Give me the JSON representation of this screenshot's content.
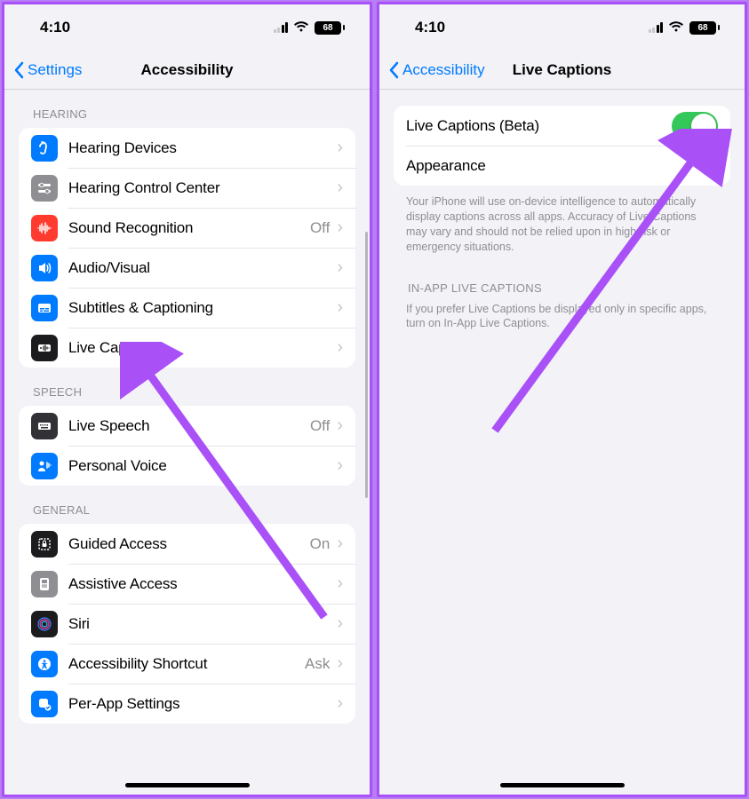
{
  "status": {
    "time": "4:10",
    "battery": "68"
  },
  "left": {
    "back": "Settings",
    "title": "Accessibility",
    "sections": [
      {
        "header": "HEARING",
        "rows": [
          {
            "icon": "ear",
            "bg": "bg-blue",
            "label": "Hearing Devices",
            "value": ""
          },
          {
            "icon": "sliders",
            "bg": "bg-gray",
            "label": "Hearing Control Center",
            "value": ""
          },
          {
            "icon": "wave",
            "bg": "bg-red",
            "label": "Sound Recognition",
            "value": "Off"
          },
          {
            "icon": "speaker",
            "bg": "bg-blue",
            "label": "Audio/Visual",
            "value": ""
          },
          {
            "icon": "caption",
            "bg": "bg-blue",
            "label": "Subtitles & Captioning",
            "value": ""
          },
          {
            "icon": "livecap",
            "bg": "bg-dark",
            "label": "Live Captions",
            "value": ""
          }
        ]
      },
      {
        "header": "SPEECH",
        "rows": [
          {
            "icon": "keyboard",
            "bg": "bg-darkgray",
            "label": "Live Speech",
            "value": "Off"
          },
          {
            "icon": "voice",
            "bg": "bg-blue",
            "label": "Personal Voice",
            "value": ""
          }
        ]
      },
      {
        "header": "GENERAL",
        "rows": [
          {
            "icon": "lock",
            "bg": "bg-dark",
            "label": "Guided Access",
            "value": "On"
          },
          {
            "icon": "assist",
            "bg": "bg-gray",
            "label": "Assistive Access",
            "value": ""
          },
          {
            "icon": "siri",
            "bg": "bg-siri",
            "label": "Siri",
            "value": ""
          },
          {
            "icon": "shortcut",
            "bg": "bg-blue",
            "label": "Accessibility Shortcut",
            "value": "Ask"
          },
          {
            "icon": "perapp",
            "bg": "bg-blue",
            "label": "Per-App Settings",
            "value": ""
          }
        ]
      }
    ]
  },
  "right": {
    "back": "Accessibility",
    "title": "Live Captions",
    "rows": [
      {
        "label": "Live Captions (Beta)",
        "type": "toggle",
        "on": true
      },
      {
        "label": "Appearance",
        "type": "nav"
      }
    ],
    "footer1": "Your iPhone will use on-device intelligence to automatically display captions across all apps. Accuracy of Live Captions may vary and should not be relied upon in high-risk or emergency situations.",
    "header2": "IN-APP LIVE CAPTIONS",
    "footer2": "If you prefer Live Captions be displayed only in specific apps, turn on In-App Live Captions."
  }
}
